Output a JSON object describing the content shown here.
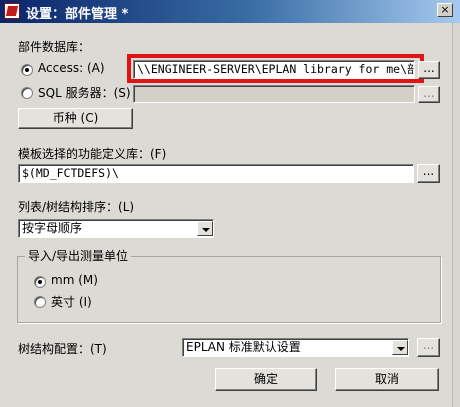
{
  "window": {
    "title": "设置：部件管理 *",
    "close_glyph": "×"
  },
  "part_db": {
    "section_label": "部件数据库：",
    "access": {
      "label": "Access: (A)",
      "checked": true,
      "path": "\\\\ENGINEER-SERVER\\EPLAN library for me\\部件\\ES",
      "browse_label": "..."
    },
    "sql": {
      "label": "SQL 服务器：(S)",
      "checked": false,
      "value": "",
      "browse_label": "..."
    },
    "currency_button": "币种 (C)"
  },
  "func_def": {
    "label": "模板选择的功能定义库：(F)",
    "value": "$(MD_FCTDEFS)\\",
    "browse_label": "..."
  },
  "sorting": {
    "label": "列表/树结构排序：(L)",
    "selected": "按字母顺序"
  },
  "units": {
    "group_title": "导入/导出测量单位",
    "mm": {
      "label": "mm (M)",
      "checked": true
    },
    "inch": {
      "label": "英寸 (I)",
      "checked": false
    }
  },
  "tree_config": {
    "label": "树结构配置：(T)",
    "selected": "EPLAN 标准默认设置",
    "browse_label": "..."
  },
  "buttons": {
    "ok": "确定",
    "cancel": "取消"
  },
  "colors": {
    "highlight": "#e01414",
    "titlebar": "#0a246a"
  }
}
